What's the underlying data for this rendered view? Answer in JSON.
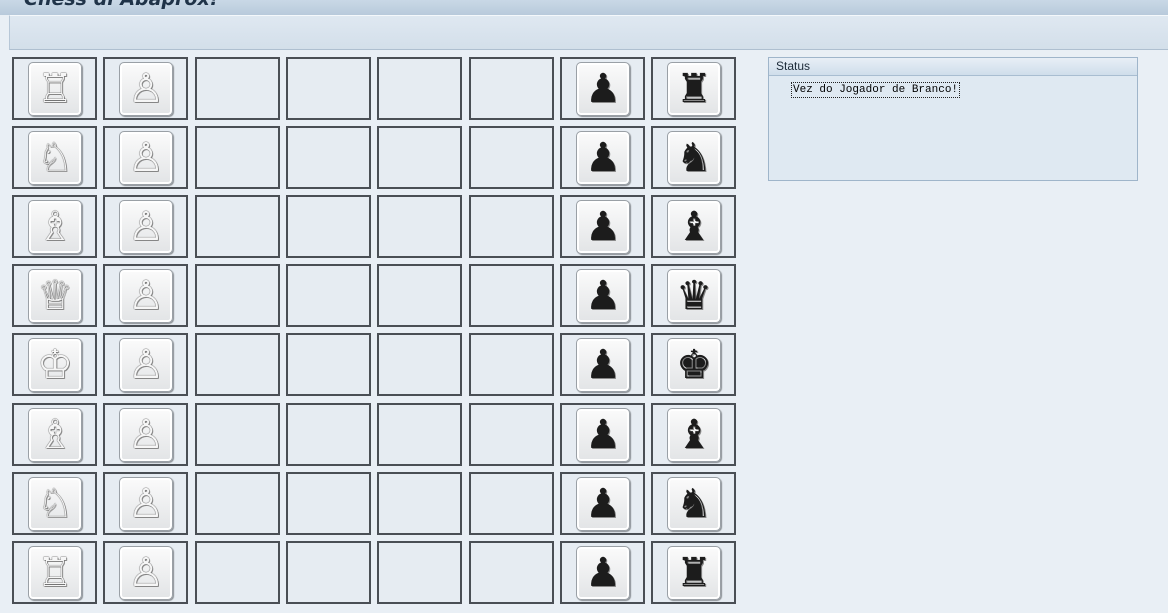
{
  "app": {
    "title": "Chess di Abaprox!"
  },
  "status": {
    "header": "Status",
    "message": "Vez do Jogador de Branco!"
  },
  "board": {
    "rows": [
      [
        "white-rook",
        "white-pawn",
        "",
        "",
        "",
        "",
        "black-pawn",
        "black-rook"
      ],
      [
        "white-knight",
        "white-pawn",
        "",
        "",
        "",
        "",
        "black-pawn",
        "black-knight"
      ],
      [
        "white-bishop",
        "white-pawn",
        "",
        "",
        "",
        "",
        "black-pawn",
        "black-bishop"
      ],
      [
        "white-queen",
        "white-pawn",
        "",
        "",
        "",
        "",
        "black-pawn",
        "black-queen"
      ],
      [
        "white-king",
        "white-pawn",
        "",
        "",
        "",
        "",
        "black-pawn",
        "black-king"
      ],
      [
        "white-bishop",
        "white-pawn",
        "",
        "",
        "",
        "",
        "black-pawn",
        "black-bishop"
      ],
      [
        "white-knight",
        "white-pawn",
        "",
        "",
        "",
        "",
        "black-pawn",
        "black-knight"
      ],
      [
        "white-rook",
        "white-pawn",
        "",
        "",
        "",
        "",
        "black-pawn",
        "black-rook"
      ]
    ]
  },
  "colors": {
    "background": "#e9eff5",
    "cell_border": "#4a4f55",
    "panel_border": "#9fb5ca"
  }
}
